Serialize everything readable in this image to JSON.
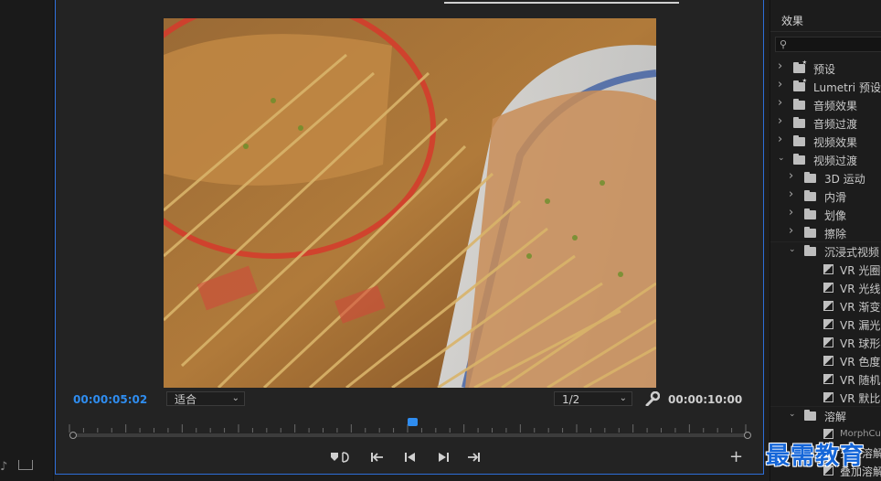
{
  "monitor": {
    "current_time": "00:00:05:02",
    "total_time": "00:00:10:00",
    "zoom_select": "适合",
    "resolution_select": "1/2",
    "playhead_position": 0.5
  },
  "transport": {
    "add_marker": "add-marker",
    "mark_in": "mark-in",
    "go_to_in": "go-to-in",
    "step_back": "step-back",
    "step_forward": "step-forward",
    "go_to_out": "go-to-out",
    "add_button": "+"
  },
  "effects_panel": {
    "title": "效果",
    "search_placeholder": "",
    "items": [
      {
        "label": "预设",
        "level": 0,
        "expanded": false,
        "type": "preset"
      },
      {
        "label": "Lumetri 预设",
        "level": 0,
        "expanded": false,
        "type": "preset"
      },
      {
        "label": "音频效果",
        "level": 0,
        "expanded": false,
        "type": "folder"
      },
      {
        "label": "音频过渡",
        "level": 0,
        "expanded": false,
        "type": "folder"
      },
      {
        "label": "视频效果",
        "level": 0,
        "expanded": false,
        "type": "folder"
      },
      {
        "label": "视频过渡",
        "level": 0,
        "expanded": true,
        "type": "folder"
      },
      {
        "label": "3D 运动",
        "level": 1,
        "expanded": false,
        "type": "folder"
      },
      {
        "label": "内滑",
        "level": 1,
        "expanded": false,
        "type": "folder"
      },
      {
        "label": "划像",
        "level": 1,
        "expanded": false,
        "type": "folder"
      },
      {
        "label": "擦除",
        "level": 1,
        "expanded": false,
        "type": "folder"
      },
      {
        "label": "沉浸式视频",
        "level": 1,
        "expanded": true,
        "type": "folder"
      },
      {
        "label": "VR 光圈擦",
        "level": 2,
        "type": "effect"
      },
      {
        "label": "VR 光线",
        "level": 2,
        "type": "effect"
      },
      {
        "label": "VR 渐变擦",
        "level": 2,
        "type": "effect"
      },
      {
        "label": "VR 漏光",
        "level": 2,
        "type": "effect"
      },
      {
        "label": "VR 球形模",
        "level": 2,
        "type": "effect"
      },
      {
        "label": "VR 色度泄",
        "level": 2,
        "type": "effect"
      },
      {
        "label": "VR 随机块",
        "level": 2,
        "type": "effect"
      },
      {
        "label": "VR 默比乌",
        "level": 2,
        "type": "effect"
      },
      {
        "label": "溶解",
        "level": 1,
        "expanded": true,
        "type": "folder"
      },
      {
        "label": "MorphCut",
        "level": 2,
        "type": "effect"
      },
      {
        "label": "交叉溶解",
        "level": 2,
        "type": "effect"
      },
      {
        "label": "叠加溶解",
        "level": 2,
        "type": "effect"
      }
    ]
  },
  "watermark": "最需教育",
  "colors": {
    "accent": "#2f8df0",
    "panel_border": "#2d6ed8",
    "watermark": "#1566d8"
  }
}
